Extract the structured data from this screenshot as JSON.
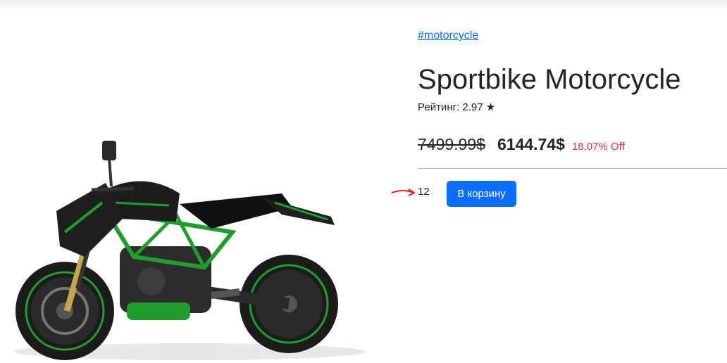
{
  "product": {
    "tag": "#motorcycle",
    "title": "Sportbike Motorcycle",
    "rating_text": "Рейтинг: 2.97 ★",
    "old_price": "7499.99$",
    "new_price": "6144.74$",
    "discount": "18.07% Off",
    "quantity": "12",
    "add_to_cart_label": "В корзину"
  },
  "colors": {
    "link": "#0d6efd",
    "button": "#0d6efd",
    "discount": "#dc3545",
    "annotation_arrow": "#e0201c",
    "bike_accent": "#1f9e2d"
  },
  "icons": {
    "rating": "star-icon",
    "annotation": "red-arrow"
  }
}
